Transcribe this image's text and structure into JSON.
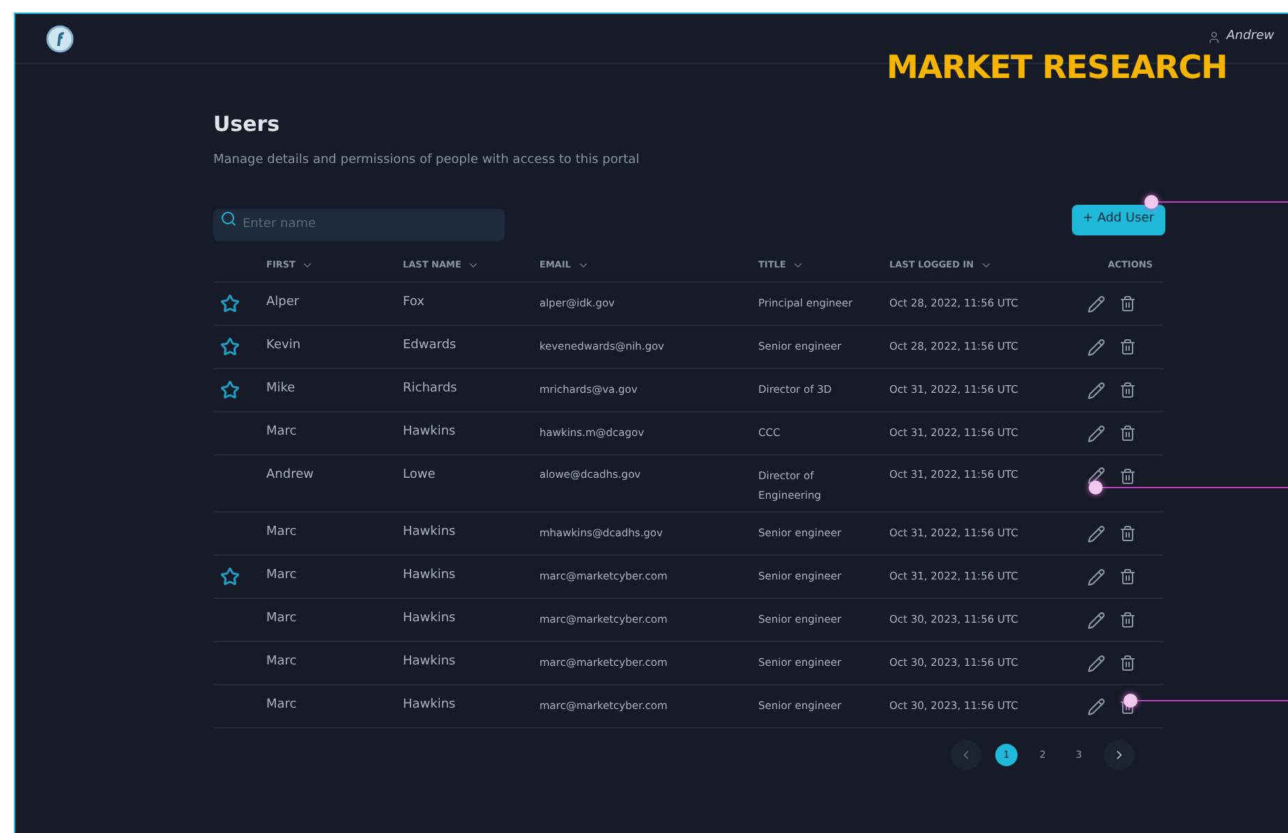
{
  "header": {
    "user": "Andrew",
    "banner": "MARKET RESEARCH"
  },
  "page": {
    "title": "Users",
    "subtitle": "Manage details and permissions of people with access to this portal"
  },
  "search": {
    "placeholder": "Enter name"
  },
  "add_button": "+ Add User",
  "table": {
    "columns": [
      "FIRST",
      "LAST NAME",
      "EMAIL",
      "TITLE",
      "LAST LOGGED IN",
      "ACTIONS"
    ],
    "rows": [
      {
        "favorite": true,
        "first": "Alper",
        "last": "Fox",
        "email": "alper@idk.gov",
        "title": "Principal engineer",
        "logged": "Oct 28, 2022, 11:56 UTC"
      },
      {
        "favorite": true,
        "first": "Kevin",
        "last": "Edwards",
        "email": "kevenedwards@nih.gov",
        "title": "Senior engineer",
        "logged": "Oct 28, 2022, 11:56 UTC"
      },
      {
        "favorite": true,
        "first": "Mike",
        "last": "Richards",
        "email": "mrichards@va.gov",
        "title": "Director of 3D",
        "logged": "Oct 31, 2022, 11:56 UTC"
      },
      {
        "favorite": false,
        "first": "Marc",
        "last": "Hawkins",
        "email": "hawkins.m@dcagov",
        "title": "CCC",
        "logged": "Oct 31, 2022, 11:56 UTC"
      },
      {
        "favorite": false,
        "first": "Andrew",
        "last": "Lowe",
        "email": "alowe@dcadhs.gov",
        "title": "Director of Engineering",
        "logged": "Oct 31, 2022, 11:56 UTC"
      },
      {
        "favorite": false,
        "first": "Marc",
        "last": "Hawkins",
        "email": "mhawkins@dcadhs.gov",
        "title": "Senior engineer",
        "logged": "Oct 31, 2022, 11:56 UTC"
      },
      {
        "favorite": true,
        "first": "Marc",
        "last": "Hawkins",
        "email": "marc@marketcyber.com",
        "title": "Senior engineer",
        "logged": "Oct 31, 2022, 11:56 UTC"
      },
      {
        "favorite": false,
        "first": "Marc",
        "last": "Hawkins",
        "email": "marc@marketcyber.com",
        "title": "Senior engineer",
        "logged": "Oct 30, 2023, 11:56 UTC"
      },
      {
        "favorite": false,
        "first": "Marc",
        "last": "Hawkins",
        "email": "marc@marketcyber.com",
        "title": "Senior engineer",
        "logged": "Oct 30, 2023, 11:56 UTC"
      },
      {
        "favorite": false,
        "first": "Marc",
        "last": "Hawkins",
        "email": "marc@marketcyber.com",
        "title": "Senior engineer",
        "logged": "Oct 30, 2023, 11:56 UTC"
      }
    ]
  },
  "pagination": {
    "pages": [
      {
        "label": "1",
        "selected": true
      },
      {
        "label": "2",
        "selected": false
      },
      {
        "label": "3",
        "selected": false
      }
    ]
  }
}
